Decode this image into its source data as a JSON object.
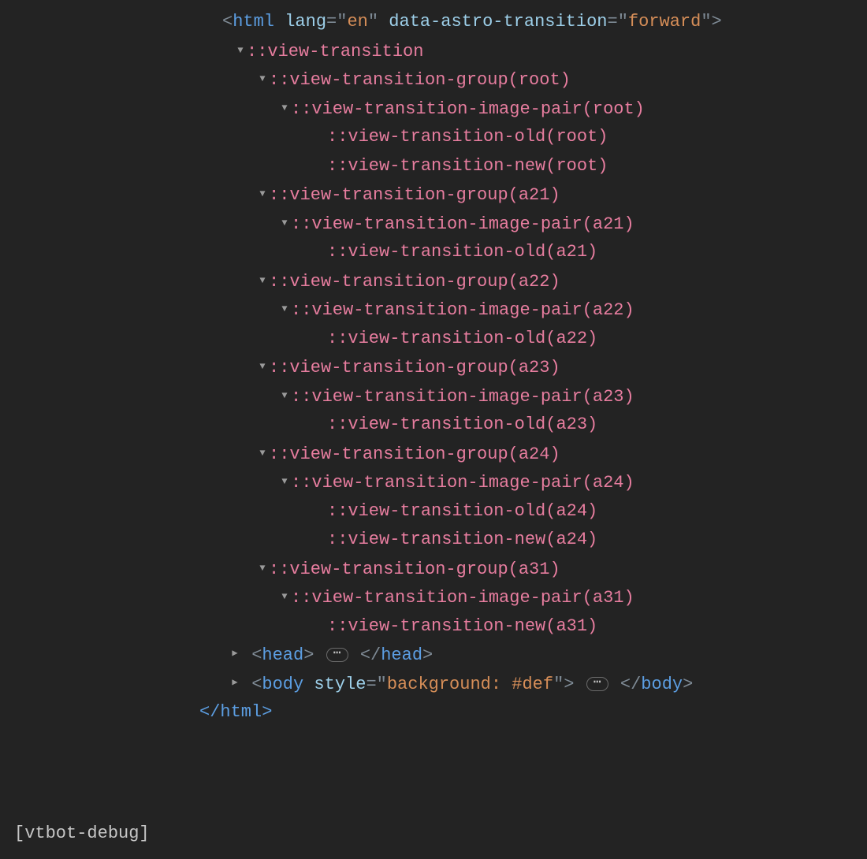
{
  "status_label": "[vtbot-debug]",
  "html_open": {
    "open": "<",
    "tag": "html",
    "space": " ",
    "attr1_name": "lang",
    "attr1_eq": "=",
    "attr1_q": "\"",
    "attr1_val": "en",
    "attr1_q2": "\"",
    "space2": " ",
    "attr2_name": "data-astro-transition",
    "attr2_eq": "=",
    "attr2_q": "\"",
    "attr2_val": "forward",
    "attr2_q2": "\"",
    "close": ">"
  },
  "html_close": {
    "full": "</html>",
    "open": "</",
    "tag": "html",
    "close": ">"
  },
  "head_row": {
    "open": "<",
    "tag": "head",
    "close": ">",
    "open2": "</",
    "tag2": "head",
    "close2": ">",
    "ellipsis": "⋯"
  },
  "body_row": {
    "open": "<",
    "tag": "body",
    "space": " ",
    "attr_name": "style",
    "eq": "=",
    "q": "\"",
    "attr_val": "background: #def",
    "q2": "\"",
    "close": ">",
    "open2": "</",
    "tag2": "body",
    "close2": ">",
    "ellipsis": "⋯"
  },
  "tree": [
    {
      "lvl": 1,
      "tri": "down",
      "text": "::view-transition"
    },
    {
      "lvl": 2,
      "tri": "down",
      "text": "::view-transition-group(root)"
    },
    {
      "lvl": 3,
      "tri": "down",
      "text": "::view-transition-image-pair(root)"
    },
    {
      "lvl": 4,
      "tri": "",
      "text": "::view-transition-old(root)"
    },
    {
      "lvl": 4,
      "tri": "",
      "text": "::view-transition-new(root)"
    },
    {
      "lvl": 2,
      "tri": "down",
      "text": "::view-transition-group(a21)"
    },
    {
      "lvl": 3,
      "tri": "down",
      "text": "::view-transition-image-pair(a21)"
    },
    {
      "lvl": 4,
      "tri": "",
      "text": "::view-transition-old(a21)"
    },
    {
      "lvl": 2,
      "tri": "down",
      "text": "::view-transition-group(a22)"
    },
    {
      "lvl": 3,
      "tri": "down",
      "text": "::view-transition-image-pair(a22)"
    },
    {
      "lvl": 4,
      "tri": "",
      "text": "::view-transition-old(a22)"
    },
    {
      "lvl": 2,
      "tri": "down",
      "text": "::view-transition-group(a23)"
    },
    {
      "lvl": 3,
      "tri": "down",
      "text": "::view-transition-image-pair(a23)"
    },
    {
      "lvl": 4,
      "tri": "",
      "text": "::view-transition-old(a23)"
    },
    {
      "lvl": 2,
      "tri": "down",
      "text": "::view-transition-group(a24)"
    },
    {
      "lvl": 3,
      "tri": "down",
      "text": "::view-transition-image-pair(a24)"
    },
    {
      "lvl": 4,
      "tri": "",
      "text": "::view-transition-old(a24)"
    },
    {
      "lvl": 4,
      "tri": "",
      "text": "::view-transition-new(a24)"
    },
    {
      "lvl": 2,
      "tri": "down",
      "text": "::view-transition-group(a31)"
    },
    {
      "lvl": 3,
      "tri": "down",
      "text": "::view-transition-image-pair(a31)"
    },
    {
      "lvl": 4,
      "tri": "",
      "text": "::view-transition-new(a31)"
    }
  ]
}
